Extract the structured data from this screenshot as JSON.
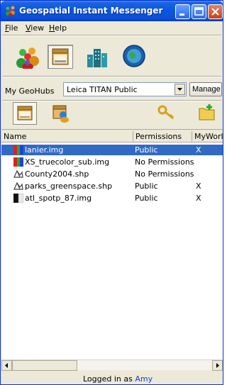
{
  "window": {
    "title": "Geospatial Instant Messenger",
    "title_icon": "people-icon",
    "buttons": [
      "minimize",
      "maximize",
      "close"
    ]
  },
  "menu": {
    "file": "File",
    "view": "View",
    "help": "Help"
  },
  "toolbar": {
    "icons": [
      "contacts-icon",
      "data-store-icon",
      "buildings-icon",
      "globe-icon"
    ],
    "active": "data-store-icon"
  },
  "geohubs": {
    "label": "My GeoHubs",
    "selected": "Leica TITAN Public",
    "manage_label": "Manage"
  },
  "secondary_toolbar": {
    "icons": [
      "data-list-icon",
      "share-data-icon",
      "key-icon",
      "add-folder-icon"
    ]
  },
  "list": {
    "columns": [
      "Name",
      "Permissions",
      "MyWorld"
    ],
    "rows": [
      {
        "name": "lanier.img",
        "permissions": "Public",
        "myworld": "X",
        "icon": "raster-image-icon",
        "selected": true
      },
      {
        "name": "XS_truecolor_sub.img",
        "permissions": "No Permissions",
        "myworld": "",
        "icon": "raster-image-icon",
        "selected": false
      },
      {
        "name": "County2004.shp",
        "permissions": "No Permissions",
        "myworld": "",
        "icon": "vector-shape-icon",
        "selected": false
      },
      {
        "name": "parks_greenspace.shp",
        "permissions": "Public",
        "myworld": "X",
        "icon": "vector-shape-icon",
        "selected": false
      },
      {
        "name": "atl_spotp_87.img",
        "permissions": "Public",
        "myworld": "X",
        "icon": "grayscale-image-icon",
        "selected": false
      }
    ]
  },
  "status": {
    "prefix": "Logged in as",
    "user": "Amy"
  },
  "colors": {
    "selection": "#316ac5",
    "title_bar": "#0a55e0",
    "user_link": "#1a3ec8"
  }
}
